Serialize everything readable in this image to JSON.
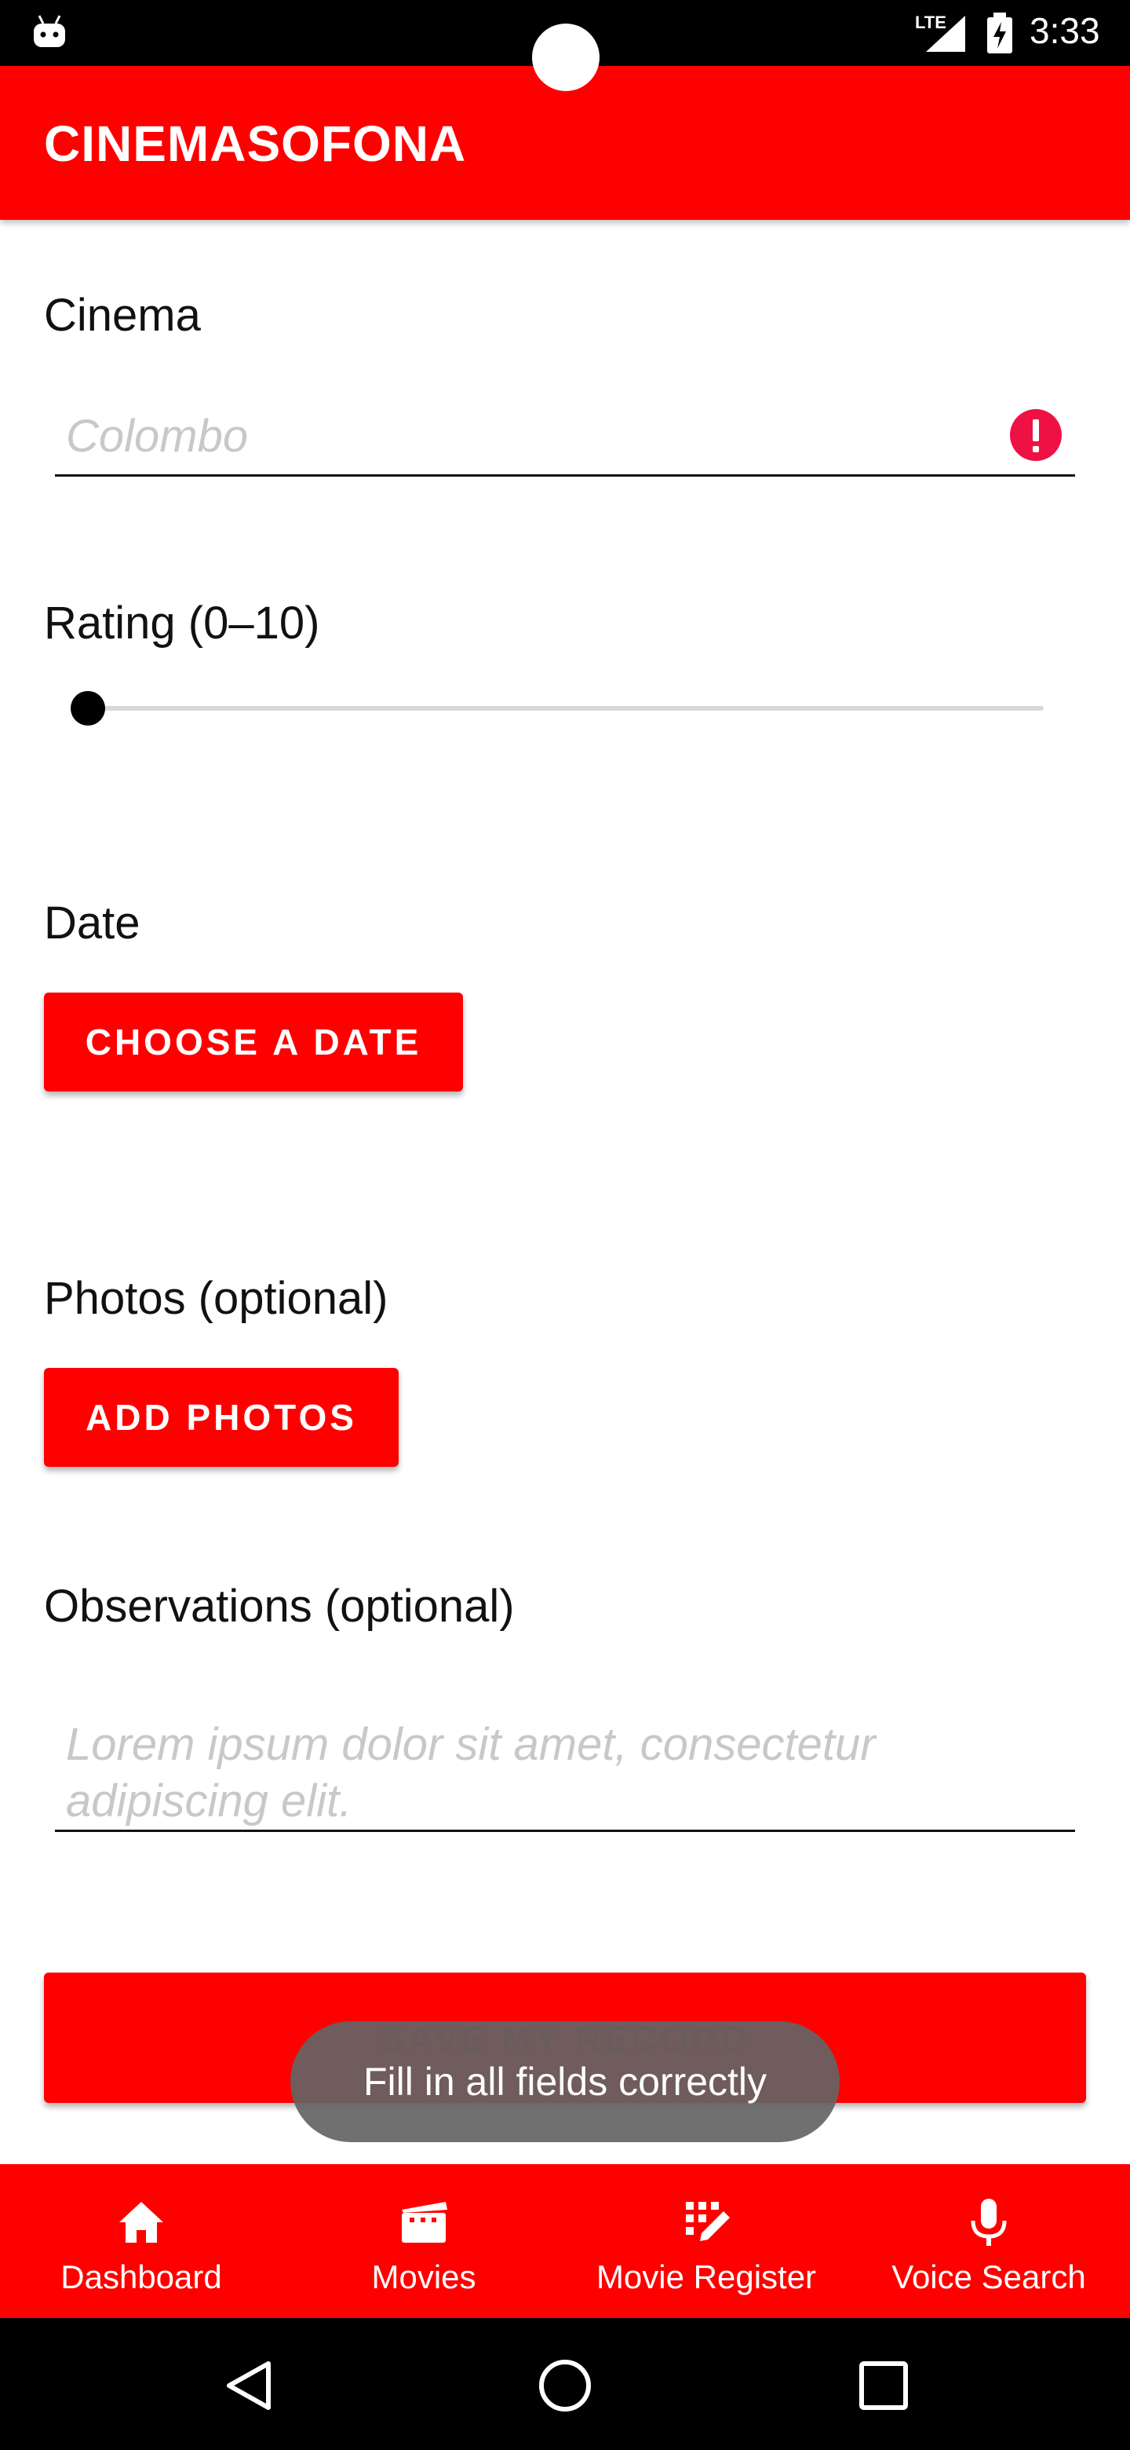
{
  "status_bar": {
    "network": "LTE",
    "time": "3:33",
    "icons": [
      "android-icon",
      "signal-icon",
      "battery-charging-icon"
    ]
  },
  "app_bar": {
    "title": "CINEMASOFONA"
  },
  "form": {
    "cinema": {
      "label": "Cinema",
      "placeholder": "Colombo",
      "value": "",
      "error_icon": "error-icon"
    },
    "rating": {
      "label": "Rating (0–10)",
      "min": 0,
      "max": 10,
      "value": 0
    },
    "date": {
      "label": "Date",
      "button": "CHOOSE A DATE"
    },
    "photos": {
      "label": "Photos (optional)",
      "button": "ADD PHOTOS"
    },
    "observations": {
      "label": "Observations (optional)",
      "placeholder": "Lorem ipsum dolor sit amet, consectetur adipiscing elit.",
      "value": ""
    },
    "save_button": "SAVE MY RECORD"
  },
  "toast": "Fill in all fields correctly",
  "bottom_nav": [
    {
      "label": "Dashboard",
      "icon": "home-icon"
    },
    {
      "label": "Movies",
      "icon": "movie-icon"
    },
    {
      "label": "Movie Register",
      "icon": "edit-grid-icon"
    },
    {
      "label": "Voice Search",
      "icon": "mic-icon"
    }
  ],
  "system_nav": [
    "back-icon",
    "home-circle-icon",
    "recents-icon"
  ],
  "colors": {
    "primary": "#ff0000",
    "error": "#ee1144",
    "toast": "#646464"
  }
}
